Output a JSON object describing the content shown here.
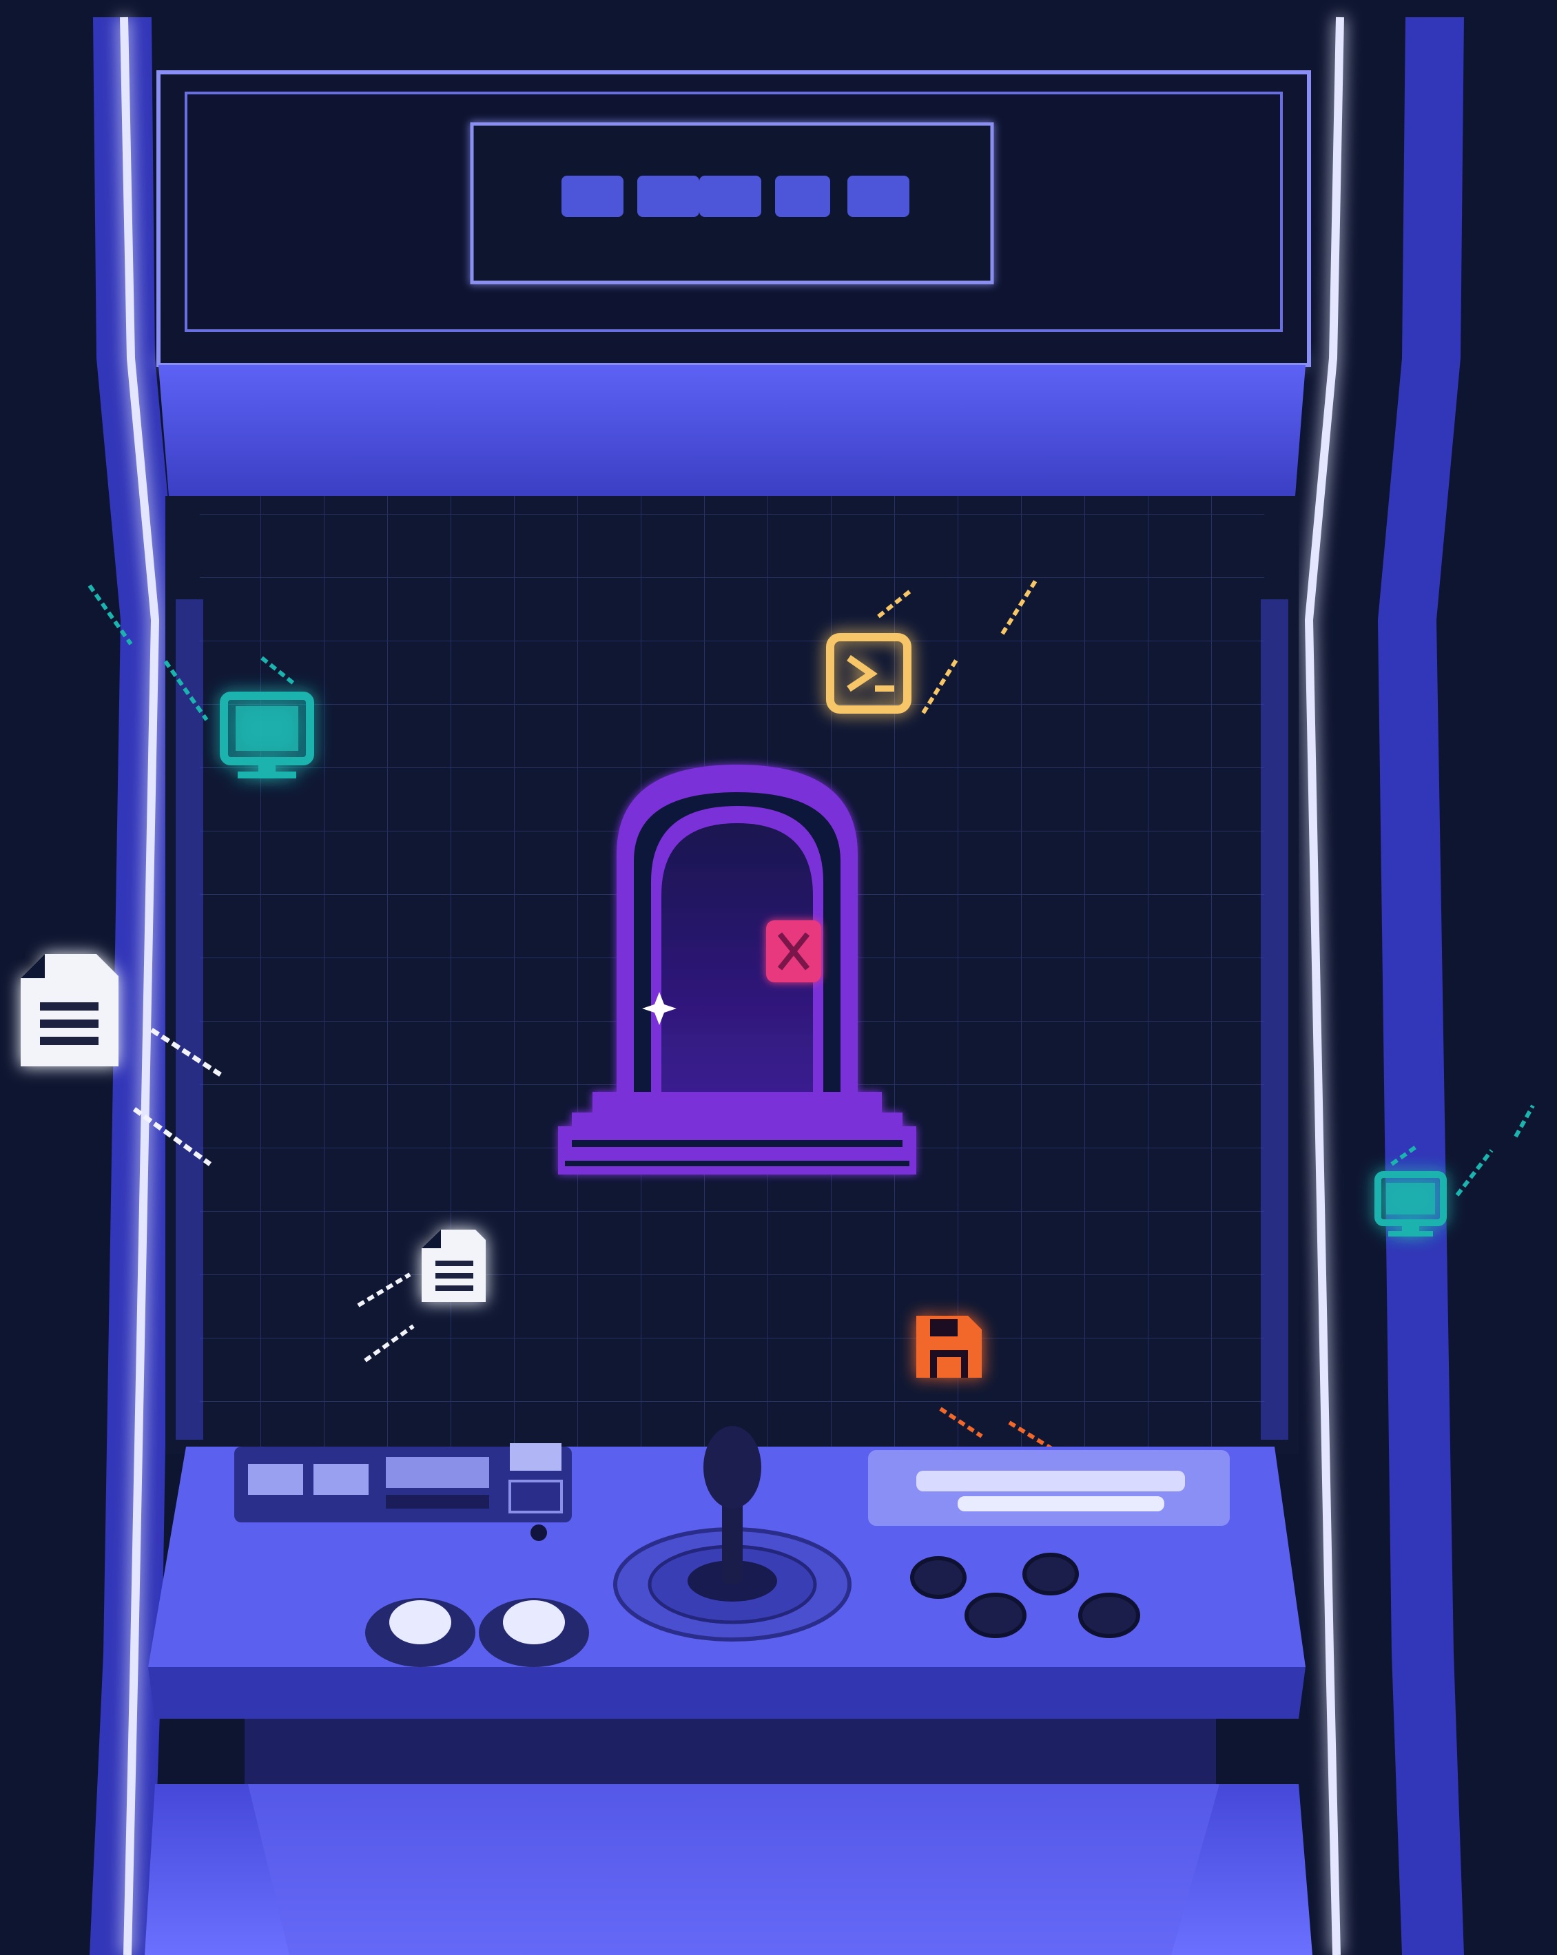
{
  "colors": {
    "background": "#0e1530",
    "cabinet": "#5256f0",
    "cabinet_dark": "#2d30a8",
    "neon": "#c9ccff",
    "screen": "#0f1733",
    "grid": "#2a3466",
    "portal": "#7a30d8",
    "portal_inner": "#2a1670",
    "close_badge": "#e8387e",
    "terminal": "#f6c667",
    "monitor": "#1bb3ae",
    "document": "#f2f4fa",
    "floppy": "#f2672a"
  },
  "icons": {
    "portal": "pixel-portal-door-icon",
    "close": "close-x-icon",
    "terminal": "terminal-prompt-icon",
    "monitor": "monitor-icon",
    "document": "document-icon",
    "floppy": "floppy-disk-icon",
    "sparkle": "sparkle-icon"
  }
}
